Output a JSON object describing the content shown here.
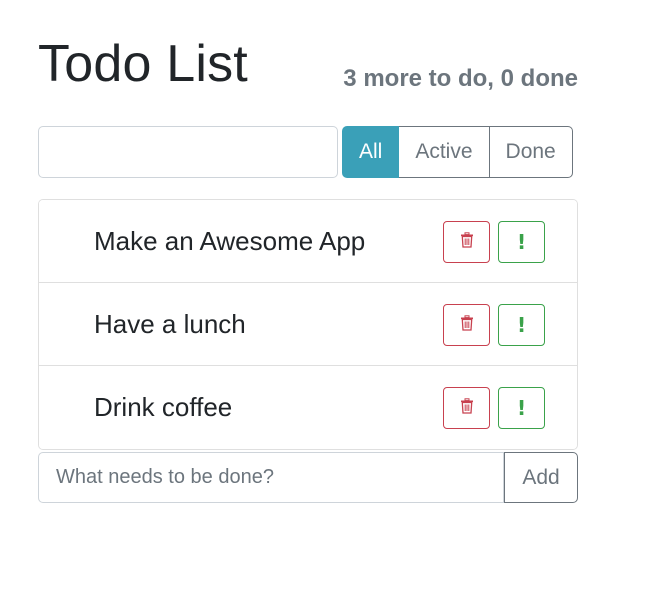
{
  "header": {
    "title": "Todo List",
    "summary": "3 more to do, 0 done"
  },
  "search": {
    "value": "",
    "placeholder": ""
  },
  "filters": [
    {
      "label": "All",
      "active": true
    },
    {
      "label": "Active",
      "active": false
    },
    {
      "label": "Done",
      "active": false
    }
  ],
  "todos": [
    {
      "label": "Make an Awesome App",
      "delete_icon": "trash-icon",
      "important_icon": "exclamation-icon",
      "important_label": "!"
    },
    {
      "label": "Have a lunch",
      "delete_icon": "trash-icon",
      "important_icon": "exclamation-icon",
      "important_label": "!"
    },
    {
      "label": "Drink coffee",
      "delete_icon": "trash-icon",
      "important_icon": "exclamation-icon",
      "important_label": "!"
    }
  ],
  "add_form": {
    "placeholder": "What needs to be done?",
    "value": "",
    "button_label": "Add"
  },
  "colors": {
    "accent": "#3aa0b8",
    "danger": "#c8414f",
    "success": "#3aa24a",
    "muted": "#6c757d"
  }
}
